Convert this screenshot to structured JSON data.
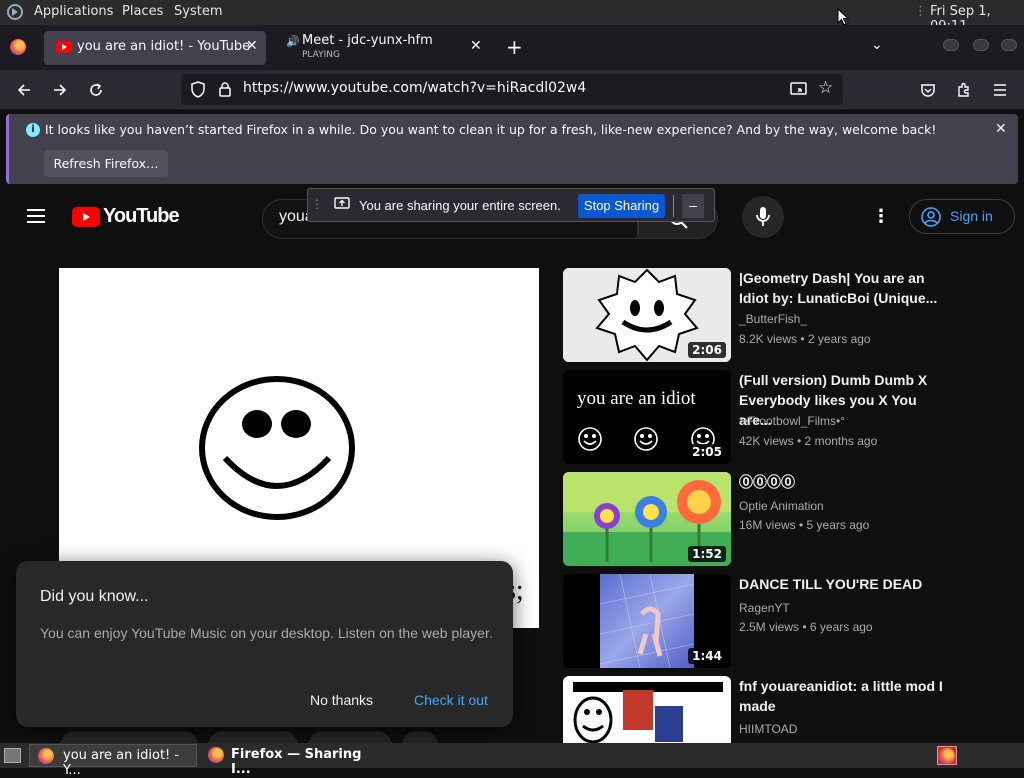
{
  "top_panel": {
    "menus": [
      "Applications",
      "Places",
      "System"
    ],
    "clock": "Fri Sep  1, 09:11"
  },
  "tabs": [
    {
      "title": "you are an idiot! - YouTube",
      "active": true
    },
    {
      "title": "Meet - jdc-yunx-hfm",
      "subtitle": "PLAYING",
      "active": false
    }
  ],
  "url": "https://www.youtube.com/watch?v=hiRacdl02w4",
  "notification": {
    "message": "It looks like you haven’t started Firefox in a while. Do you want to clean it up for a fresh, like-new experience? And by the way, welcome back!",
    "button": "Refresh Firefox…"
  },
  "sharing_bar": {
    "message": "You are sharing your entire screen.",
    "stop_button": "Stop Sharing",
    "minimize": "–"
  },
  "youtube": {
    "logo_text": "YouTube",
    "search_value": "youareanidiot meme",
    "sign_in": "Sign in",
    "player_partial_text": "s;",
    "recommendations": [
      {
        "title": "|Geometry Dash| You are an Idiot by: LunaticBoi (Unique...",
        "channel": "_ButterFish_",
        "meta": "8.2K views • 2 years ago",
        "duration": "2:06"
      },
      {
        "title": "(Full version) Dumb Dumb X Everybody likes you X You are...",
        "channel": "°•Frootbowl_Films•°",
        "meta": "42K views • 2 months ago",
        "duration": "2:05",
        "thumb_text": "you are an idiot"
      },
      {
        "title": "⓪⓪⓪⓪",
        "channel": "Optie Animation",
        "meta": "16M views • 5 years ago",
        "duration": "1:52"
      },
      {
        "title": "DANCE TILL YOU'RE DEAD",
        "channel": "RagenYT",
        "meta": "2.5M views • 6 years ago",
        "duration": "1:44"
      },
      {
        "title": "fnf youareanidiot: a little mod I made",
        "channel": "HIIMTOAD",
        "meta": "",
        "duration": ""
      }
    ],
    "popup": {
      "title": "Did you know...",
      "body": "You can enjoy YouTube Music on your desktop. Listen on the web player.",
      "dismiss": "No thanks",
      "accept": "Check it out"
    }
  },
  "taskbar": {
    "items": [
      "you are an idiot! - Y...",
      "Firefox — Sharing I..."
    ]
  },
  "colors": {
    "accent_blue": "#3ea6ff",
    "stop_sharing_bg": "#0b57d0",
    "youtube_red": "#ff0000"
  }
}
